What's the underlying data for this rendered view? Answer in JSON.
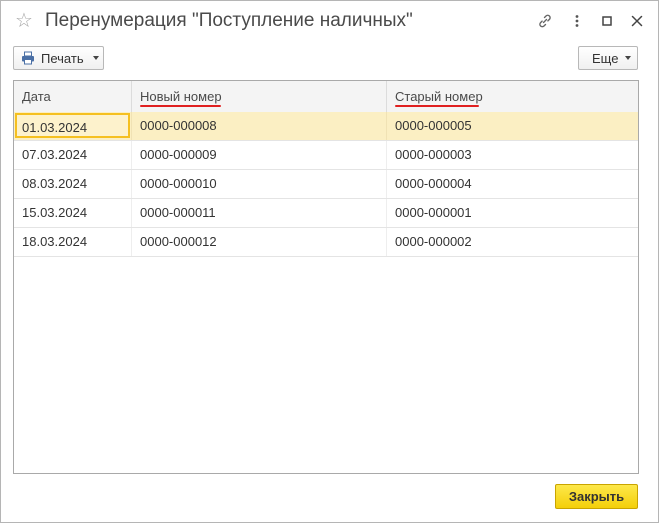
{
  "window": {
    "title": "Перенумерация \"Поступление наличных\"",
    "icons": [
      "star-icon",
      "link-icon",
      "more-vertical-icon",
      "maximize-icon",
      "close-icon"
    ]
  },
  "toolbar": {
    "print_label": "Печать",
    "more_label": "Еще"
  },
  "table": {
    "columns": [
      "Дата",
      "Новый номер",
      "Старый номер"
    ],
    "rows": [
      [
        "01.03.2024",
        "0000-000008",
        "0000-000005"
      ],
      [
        "07.03.2024",
        "0000-000009",
        "0000-000003"
      ],
      [
        "08.03.2024",
        "0000-000010",
        "0000-000004"
      ],
      [
        "15.03.2024",
        "0000-000011",
        "0000-000001"
      ],
      [
        "18.03.2024",
        "0000-000012",
        "0000-000002"
      ]
    ],
    "selected_row": 0
  },
  "footer": {
    "close_label": "Закрыть"
  },
  "colors": {
    "accent": "#f4cf0a",
    "selection": "#fbefc3",
    "annotation": "#e02020"
  }
}
